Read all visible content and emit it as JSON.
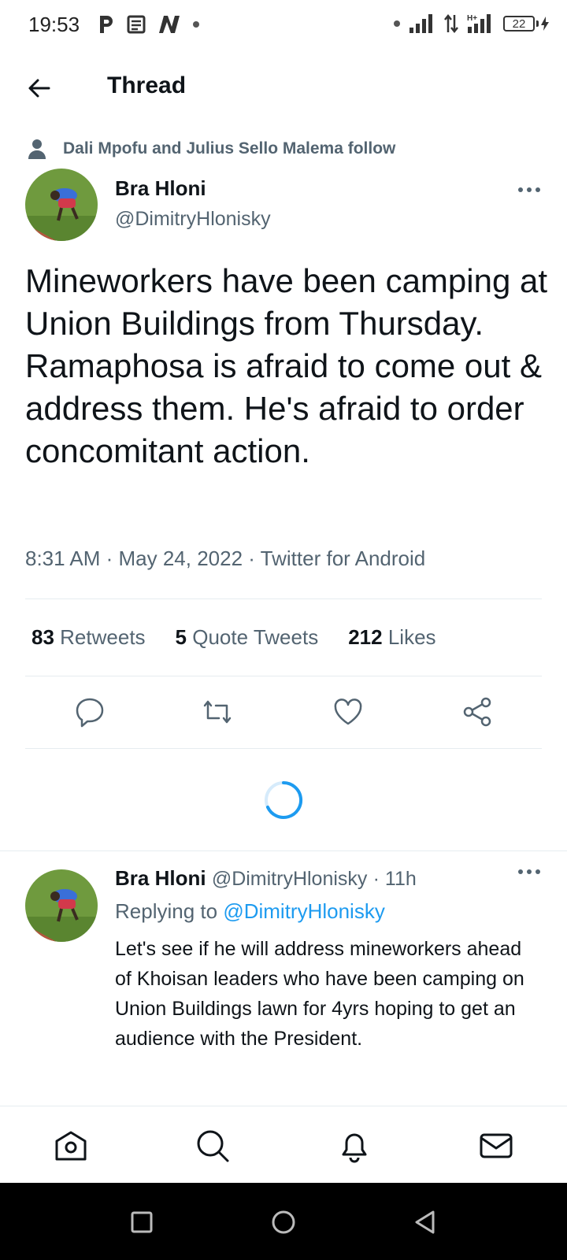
{
  "status_bar": {
    "time": "19:53",
    "left_icons": [
      "p-app-icon",
      "news-icon",
      "n-app-icon",
      "dot-icon"
    ],
    "right_icons": [
      "dot-icon",
      "signal-icon",
      "data-arrows-icon",
      "h-plus-signal-icon"
    ],
    "battery": "22"
  },
  "header": {
    "title": "Thread",
    "back_icon": "arrow-left-icon"
  },
  "main_tweet": {
    "social_context": "Dali Mpofu and Julius Sello Malema follow",
    "author_name": "Bra Hloni",
    "author_handle": "@DimitryHlonisky",
    "text": "Mineworkers have been camping at Union Buildings from Thursday. Ramaphosa is afraid to come out & address them. He's afraid to order concomitant action.",
    "meta": "8:31 AM · May 24, 2022 · Twitter for Android",
    "stats": {
      "retweets_count": "83",
      "retweets_label": "Retweets",
      "quotes_count": "5",
      "quotes_label": "Quote Tweets",
      "likes_count": "212",
      "likes_label": "Likes"
    },
    "actions": [
      "reply-icon",
      "retweet-icon",
      "like-icon",
      "share-icon"
    ]
  },
  "reply": {
    "author_name": "Bra Hloni",
    "author_handle": "@DimitryHlonisky",
    "time": "· 11h",
    "replying_prefix": "Replying to",
    "replying_to": "@DimitryHlonisky",
    "text": "Let's see if he will address mineworkers ahead of Khoisan leaders who have been camping on Union Buildings lawn for 4yrs hoping to get an audience with the President."
  },
  "bottom_nav": [
    "home-icon",
    "search-icon",
    "notifications-icon",
    "messages-icon"
  ],
  "system_nav": [
    "recents-square-icon",
    "home-circle-icon",
    "back-triangle-icon"
  ],
  "colors": {
    "accent": "#1d9bf0",
    "secondary_text": "#536471",
    "primary_text": "#0f1419"
  }
}
